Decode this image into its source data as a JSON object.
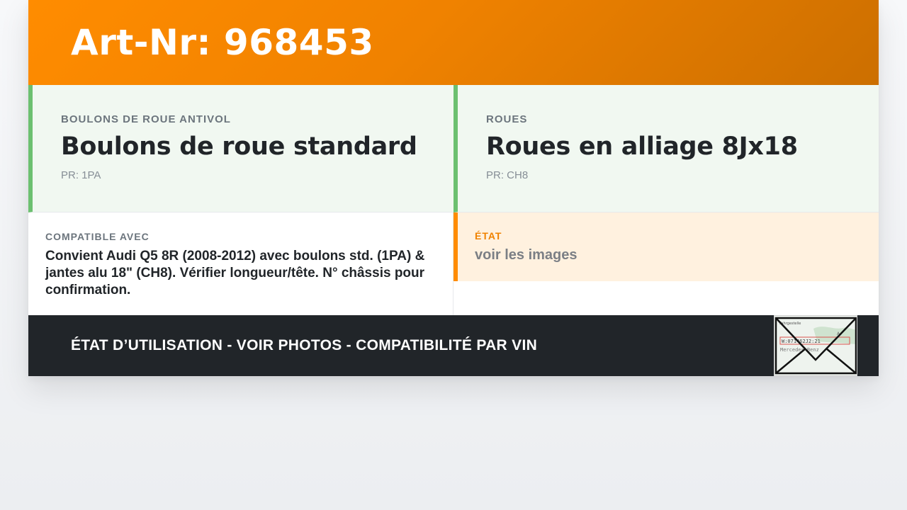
{
  "header": {
    "title": "Art-Nr: 968453"
  },
  "options": [
    {
      "category": "BOULONS DE ROUE ANTIVOL",
      "name": "Boulons de roue standard",
      "pr": "PR: 1PA"
    },
    {
      "category": "ROUES",
      "name": "Roues en alliage 8Jx18",
      "pr": "PR: CH8"
    }
  ],
  "compatibility": {
    "label": "COMPATIBLE AVEC",
    "text": "Convient Audi Q5 8R (2008-2012) avec boulons std. (1PA) & jantes alu 18\" (CH8). Vérifier longueur/tête. N° châssis pour confirmation."
  },
  "state": {
    "label": "ÉTAT",
    "value": "voir les images"
  },
  "footer": {
    "text": "ÉTAT D’UTILISATION - VOIR PHOTOS - COMPATIBILITÉ PAR VIN",
    "thumb": {
      "header": "Fahrgestelle",
      "vin": "W:071462J2:21",
      "brand": "Mercedes-Benz",
      "code": "A"
    }
  },
  "colors": {
    "accent": "#ff8c00",
    "green": "#6cc070",
    "dark": "#212529"
  },
  "icons": {
    "thumbnail_overlay": "envelope-icon"
  }
}
